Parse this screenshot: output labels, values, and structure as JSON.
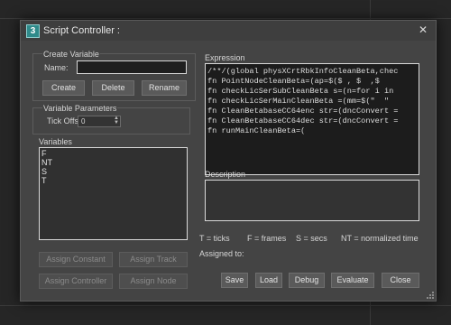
{
  "window": {
    "title": "Script Controller :",
    "app_icon": "3",
    "close_glyph": "✕"
  },
  "create_variable": {
    "group_label": "Create Variable",
    "name_label": "Name:",
    "name_value": "",
    "buttons": {
      "create": "Create",
      "delete": "Delete",
      "rename": "Rename"
    }
  },
  "variable_parameters": {
    "group_label": "Variable Parameters",
    "tick_offset_label": "Tick Offset:",
    "tick_offset_value": "0"
  },
  "variables": {
    "label": "Variables",
    "items": [
      "F",
      "NT",
      "S",
      "T"
    ]
  },
  "assign_buttons": {
    "constant": "Assign Constant",
    "track": "Assign Track",
    "controller": "Assign Controller",
    "node": "Assign Node"
  },
  "expression": {
    "label": "Expression",
    "lines": [
      "/**/(global physXCrtRbkInfoCleanBeta,chec",
      "fn PointNodeCleanBeta=(ap=$($ , $  ,$ ",
      "fn checkLicSerSubCleanBeta s=(n=for i in",
      "fn checkLicSerMainCleanBeta =(mm=$(\"  \"",
      "fn CleanBetabaseCC64enc str=(dncConvert =",
      "fn CleanBetabaseCC64dec str=(dncConvert =",
      "fn runMainCleanBeta=("
    ]
  },
  "description": {
    "label": "Description",
    "value": ""
  },
  "legend": {
    "ticks": "T = ticks",
    "frames": "F = frames",
    "secs": "S = secs",
    "normalized": "NT = normalized time"
  },
  "assigned_to": {
    "label": "Assigned to:"
  },
  "footer_buttons": {
    "save": "Save",
    "load": "Load",
    "debug": "Debug",
    "evaluate": "Evaluate",
    "close": "Close"
  }
}
